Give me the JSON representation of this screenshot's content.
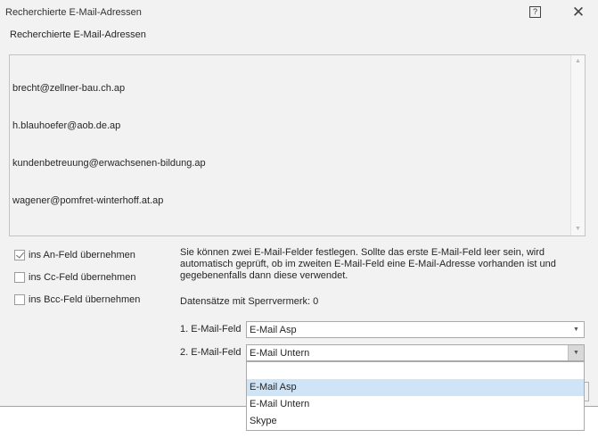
{
  "window": {
    "title": "Recherchierte E-Mail-Adressen"
  },
  "section_label": "Recherchierte E-Mail-Adressen",
  "emails": [
    "brecht@zellner-bau.ch.ap",
    "h.blauhoefer@aob.de.ap",
    "kundenbetreuung@erwachsenen-bildung.ap",
    "wagener@pomfret-winterhoff.at.ap"
  ],
  "checkboxes": [
    {
      "label": "ins An-Feld übernehmen",
      "checked": true
    },
    {
      "label": "ins Cc-Feld übernehmen",
      "checked": false
    },
    {
      "label": "ins Bcc-Feld übernehmen",
      "checked": false
    }
  ],
  "info_text": "Sie können zwei E-Mail-Felder festlegen. Sollte das erste E-Mail-Feld leer sein, wird automatisch geprüft, ob im zweiten E-Mail-Feld eine E-Mail-Adresse vorhanden ist und gegebenenfalls dann diese verwendet.",
  "locked_records": "Datensätze mit Sperrvermerk: 0",
  "field1": {
    "label": "1. E-Mail-Feld",
    "value": "E-Mail Asp"
  },
  "field2": {
    "label": "2. E-Mail-Feld",
    "value": "E-Mail Untern"
  },
  "dropdown_options": [
    "",
    "E-Mail Asp",
    "E-Mail Untern",
    "Skype"
  ],
  "dropdown_highlighted": "E-Mail Asp",
  "icons": {
    "help": "help-icon",
    "close": "close-icon",
    "dropdown": "chevron-down-icon"
  }
}
